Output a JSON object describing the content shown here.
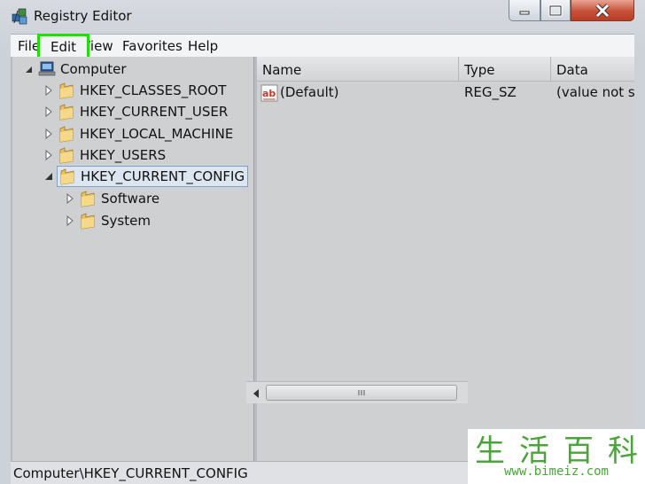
{
  "window": {
    "title": "Registry Editor"
  },
  "menu": {
    "file": "File",
    "edit": "Edit",
    "view": "View",
    "favorites": "Favorites",
    "help": "Help",
    "highlight_color": "#1fe000"
  },
  "tree": {
    "root": "Computer",
    "hives": [
      {
        "label": "HKEY_CLASSES_ROOT",
        "expanded": false
      },
      {
        "label": "HKEY_CURRENT_USER",
        "expanded": false
      },
      {
        "label": "HKEY_LOCAL_MACHINE",
        "expanded": false
      },
      {
        "label": "HKEY_USERS",
        "expanded": false
      },
      {
        "label": "HKEY_CURRENT_CONFIG",
        "expanded": true,
        "selected": true
      }
    ],
    "children": [
      {
        "label": "Software"
      },
      {
        "label": "System"
      }
    ]
  },
  "list": {
    "columns": [
      "Name",
      "Type",
      "Data"
    ],
    "rows": [
      {
        "name": "(Default)",
        "type": "REG_SZ",
        "data": "(value not s"
      }
    ]
  },
  "statusbar": {
    "path": "Computer\\HKEY_CURRENT_CONFIG"
  },
  "watermark": {
    "chars": [
      "生",
      "活",
      "百",
      "科"
    ],
    "url": "www.bimeiz.com"
  },
  "icons": {
    "app": "registry-icon",
    "folder": "folder-icon",
    "computer": "computer-icon",
    "value": "string-value-icon"
  }
}
